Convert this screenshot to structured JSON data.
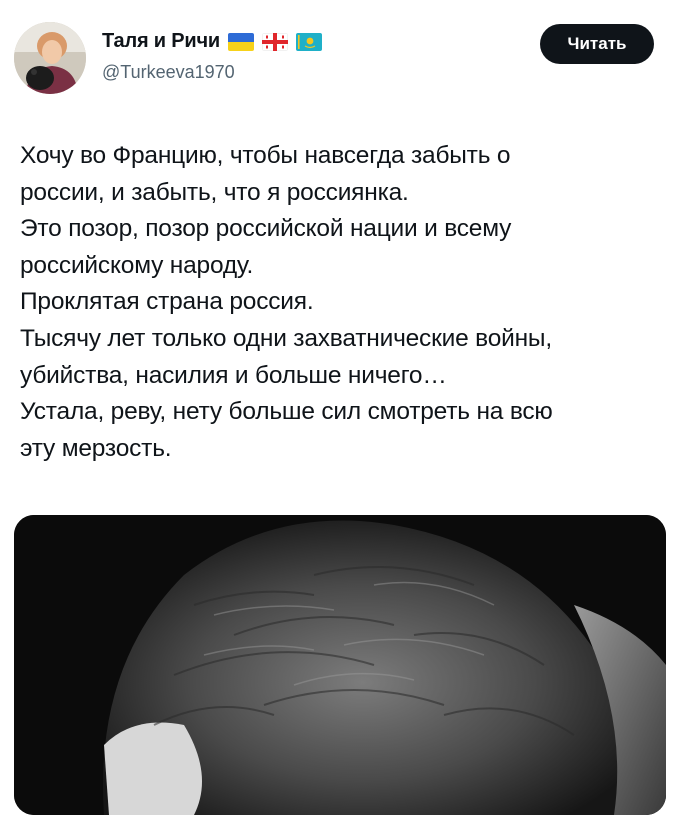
{
  "author": {
    "display_name": "Таля и Ричи",
    "handle": "@Turkeeva1970",
    "avatar_icon": "user-avatar",
    "flags": [
      "ukraine-flag-icon",
      "georgia-flag-icon",
      "kazakhstan-flag-icon"
    ]
  },
  "follow_button": {
    "label": "Читать"
  },
  "tweet": {
    "text": "Хочу во Францию, чтобы навсегда забыть о\nроссии, и забыть, что я россиянка.\nЭто позор, позор российской нации и всему\nроссийскому народу.\nПроклятая страна россия.\nТысячу лет только одни захватнические войны,\nубийства, насилия и больше ничего…\nУстала, реву, нету больше сил смотреть на всю\nэту мерзость."
  },
  "media": {
    "type": "video-thumbnail",
    "tone": "black-and-white"
  },
  "colors": {
    "text": "#0f1419",
    "secondary": "#536471",
    "button_bg": "#0f1419",
    "button_text": "#ffffff"
  }
}
